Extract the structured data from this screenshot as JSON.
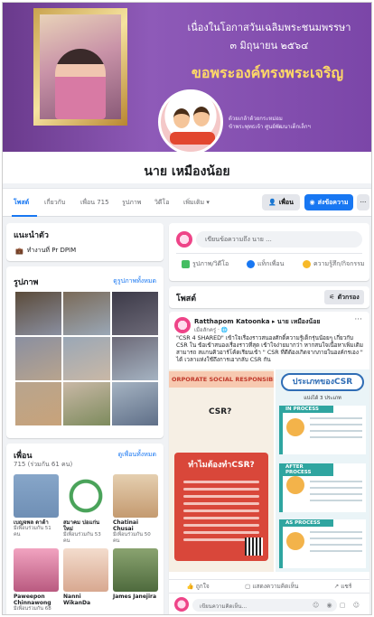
{
  "cover": {
    "line1": "เนื่องในโอกาสวันเฉลิมพระชนมพรรษา",
    "line2": "๓ มิถุนายน ๒๕๖๔",
    "line3": "ขอพระองค์ทรงพระเจริญ",
    "sub1": "ด้วยเกล้าด้วยกระหม่อม",
    "sub2": "ข้าพระพุทธเจ้า ศูนย์พัฒนาเด็กเล็กฯ"
  },
  "profile": {
    "name": "นาย เหมืองน้อย"
  },
  "tabs": [
    {
      "label": "โพสต์"
    },
    {
      "label": "เกี่ยวกับ"
    },
    {
      "label": "เพื่อน 715"
    },
    {
      "label": "รูปภาพ"
    },
    {
      "label": "วิดีโอ"
    },
    {
      "label": "เพิ่มเติม ▾"
    }
  ],
  "actions": {
    "friends_label": "เพื่อน",
    "message_label": "ส่งข้อความ",
    "more_label": "···"
  },
  "intro": {
    "title": "แนะนำตัว",
    "work": "ทำงานที่ Pr DPIM"
  },
  "photos": {
    "title": "รูปภาพ",
    "see_all": "ดูรูปภาพทั้งหมด",
    "colors": [
      "#5b4b3a",
      "#7a6a58",
      "#3c3a48",
      "#8a8fa0",
      "#9aa7b6",
      "#6d6a78",
      "#b8a48e",
      "#c9b8a6",
      "#a5b3c2",
      "#c8a37a",
      "#7d8b5d",
      "#5f6f88",
      "#8b7763",
      "#a89480",
      "#6e7c92"
    ]
  },
  "friends": {
    "title": "เพื่อน",
    "see_all": "ดูเพื่อนทั้งหมด",
    "count": "715 (ร่วมกัน 61 คน)",
    "items": [
      {
        "name": "เบญจพล ดาต้า",
        "mutual": "มีเพื่อนร่วมกัน 51 คน",
        "color": "#6f8fb5"
      },
      {
        "name": "สมาคม ปอแก่น ใหม่",
        "mutual": "มีเพื่อนร่วมกัน 53 คน",
        "color": "#4aa35a"
      },
      {
        "name": "Chatinai Chusai",
        "mutual": "มีเพื่อนร่วมกัน 50 คน",
        "color": "#d8b48c"
      },
      {
        "name": "Paweepon Chinnawong",
        "mutual": "มีเพื่อนร่วมกัน 68",
        "color": "#c66b8a"
      },
      {
        "name": "Nanni WikanDa",
        "mutual": "",
        "color": "#e7c6b3"
      },
      {
        "name": "James Janejira",
        "mutual": "",
        "color": "#5d7a4c"
      }
    ]
  },
  "composer": {
    "placeholder": "เขียนข้อความถึง นาย ...",
    "photo": "รูปภาพ/วิดีโอ",
    "tag": "แท็กเพื่อน",
    "feeling": "ความรู้สึก/กิจกรรม"
  },
  "posts": {
    "title": "โพสต์",
    "filter": "ตัวกรอง"
  },
  "post": {
    "author": "Ratthapom Katoonka ▸ นาย เหมืองน้อย",
    "meta": "เมื่อสักครู่ · 🌐",
    "more": "···",
    "text": "\"CSR 4 SHARED\" เข้าใจเรื่องราวสนองศักดิ์ความรู้เด็กรุ่นน้อยๆ เกี่ยวกับ CSR ใน ข้อเข้าสนองเรื่องราวที่สุด เข้าใจง่ายมากว่า หากสนใจเนื้อหาเพิ่มเติมสามารถ สแกนคิวอาร์โค้ดเรียนเข้า \" CSR ที่ดีต้องเกิดจากภายในองค์กรเอง \" ได้ เวลาแห่งใช้ถึงการเอากลับ CSR กัน",
    "left": {
      "band": "ORPORATE SOCIAL RESPONSIBILI",
      "q1": "CSR?",
      "q2": "ทำไมต้องทำCSR?"
    },
    "right": {
      "title": "ประเภทของCSR",
      "sub": "แบ่งได้ 3 ประเภท",
      "stages": [
        "IN PROCESS",
        "AFTER PROCESS",
        "AS PROCESS"
      ]
    },
    "like": "ถูกใจ",
    "comment": "แสดงความคิดเห็น",
    "share": "แชร์",
    "comment_placeholder": "เขียนความคิดเห็น...",
    "comment_icons": "☺ ◉ ▢ ☺"
  }
}
